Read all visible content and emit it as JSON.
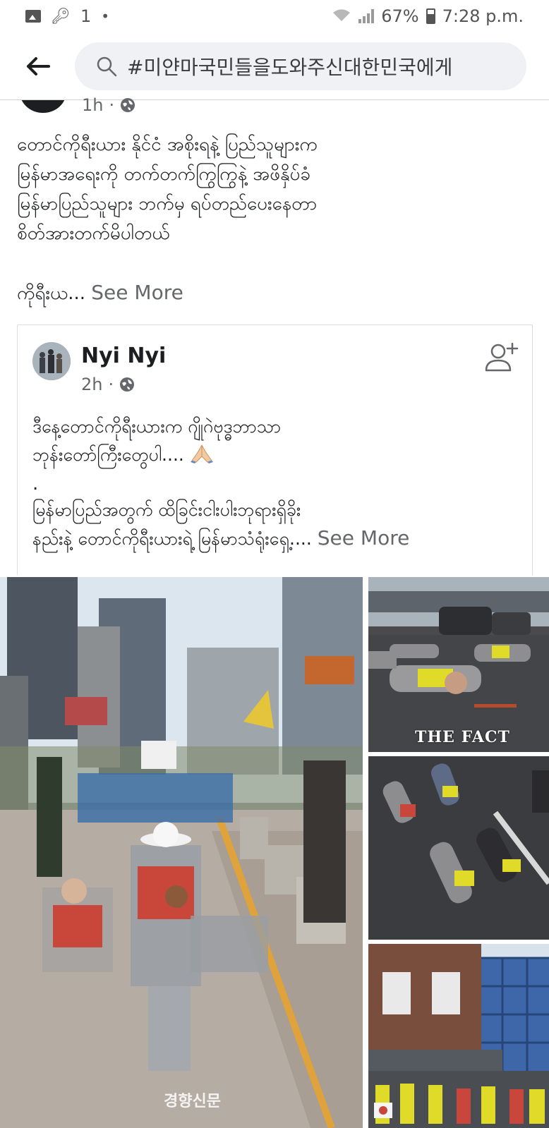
{
  "status_bar": {
    "notification_count": "1",
    "battery": "67%",
    "time": "7:28 p.m."
  },
  "search": {
    "query": "#미얀마국민들을도와주신대한민국에게"
  },
  "outer_post": {
    "time": "1h",
    "lines": [
      "တောင်ကိုရီးယား နိုင်ငံ အစိုးရနဲ့ ပြည်သူများက",
      "မြန်မာအရေးကို တက်တက်ကြွကြွနဲ့ အဖိနှိပ်ခံ",
      "မြန်မာပြည်သူများ ဘက်မှ ရပ်တည်ပေးနေတာ",
      "စိတ်အားတက်မိပါတယ်"
    ],
    "truncated_line": "ကိုရီးယ...",
    "see_more": "See More"
  },
  "shared_post": {
    "author": "Nyi Nyi",
    "time": "2h",
    "lines": [
      "ဒီနေ့တောင်ကိုရီးယားက ဂျိုဂဲဗုဒ္ဓဘာသာ",
      "ဘုန်းတော်ကြီးတွေပါ...."
    ],
    "dot": ".",
    "lines_2": [
      "မြန်မာပြည်အတွက် ထိခြင်းငါးပါးဘုရားရှိခိုး"
    ],
    "truncated_line": "နည်းနဲ့ တောင်ကိုရီးယားရဲ့ မြန်မာသံရုံးရှေ့....",
    "see_more": "See More"
  },
  "photos": {
    "main_watermark": "경향신문",
    "fact_watermark": "THE FACT"
  },
  "colors": {
    "text_primary": "#1c1e21",
    "text_secondary": "#65676b",
    "search_bg": "#eff1f4"
  }
}
